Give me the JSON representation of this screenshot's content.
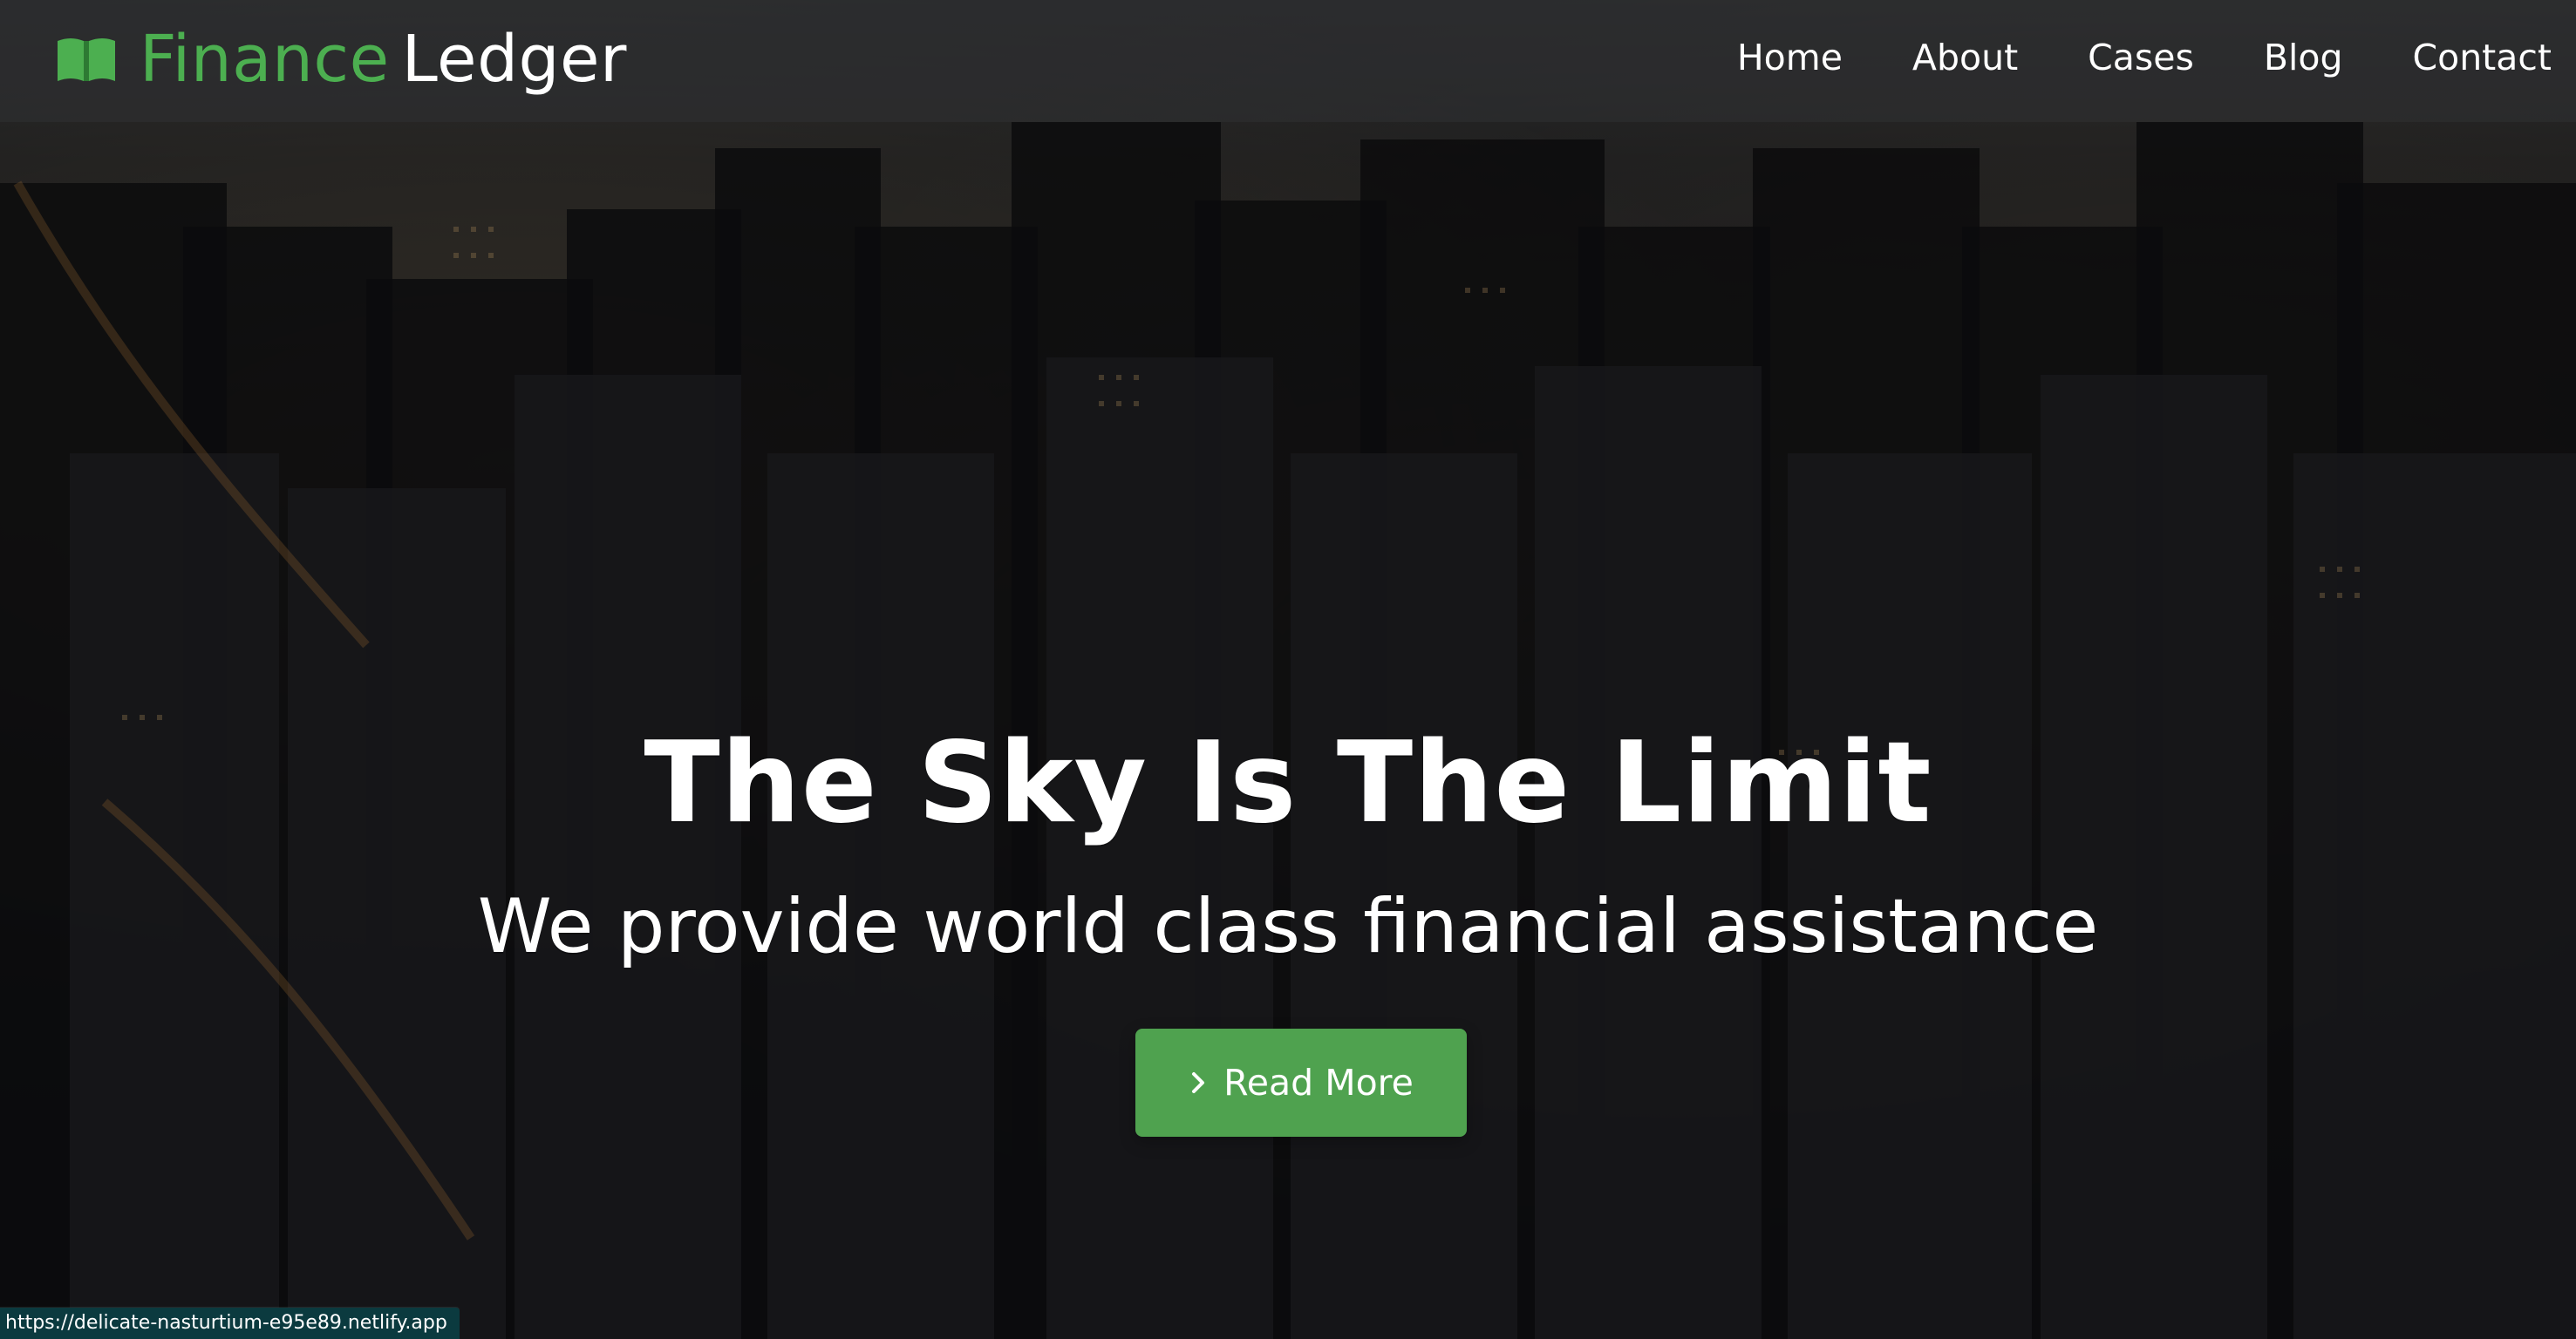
{
  "brand": {
    "word1": "Finance",
    "word2": "Ledger",
    "icon": "book-icon"
  },
  "nav": {
    "items": [
      {
        "label": "Home"
      },
      {
        "label": "About"
      },
      {
        "label": "Cases"
      },
      {
        "label": "Blog"
      },
      {
        "label": "Contact"
      }
    ]
  },
  "hero": {
    "title": "The Sky Is The Limit",
    "subtitle": "We provide world class financial assistance",
    "cta_label": "Read More",
    "cta_icon": "chevron-right-icon"
  },
  "statusbar": {
    "url": "https://delicate-nasturtium-e95e89.netlify.app"
  },
  "colors": {
    "accent": "#4caf50",
    "button": "#4fa24f",
    "text": "#ffffff",
    "overlay": "#000000"
  }
}
